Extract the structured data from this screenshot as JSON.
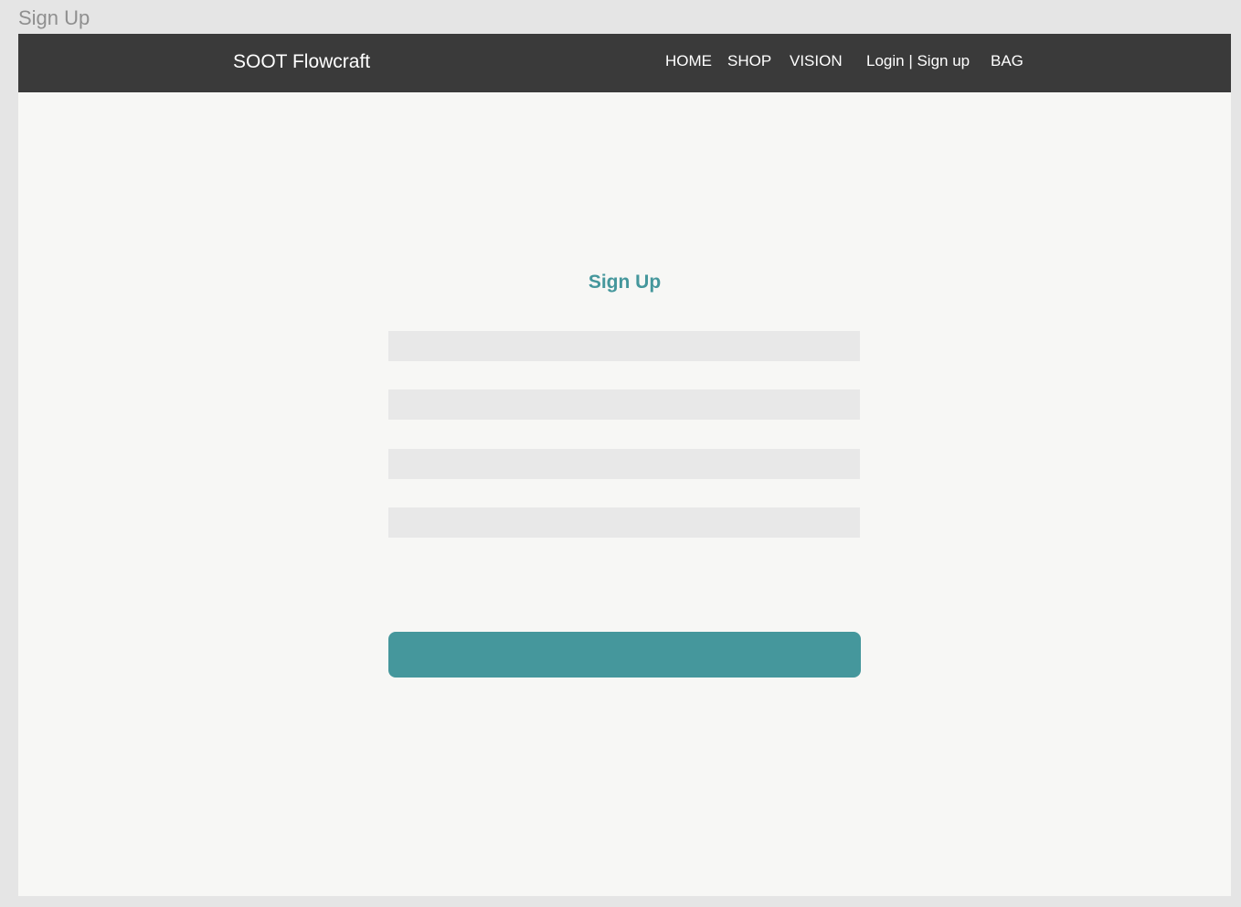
{
  "frame_label": "Sign Up",
  "navbar": {
    "brand": "SOOT Flowcraft",
    "links": {
      "home": "HOME",
      "shop": "SHOP",
      "vision": "VISION",
      "login_signup": "Login | Sign up",
      "bag": "BAG"
    }
  },
  "form": {
    "title": "Sign Up",
    "fields": [
      {
        "value": "",
        "placeholder": ""
      },
      {
        "value": "",
        "placeholder": ""
      },
      {
        "value": "",
        "placeholder": ""
      },
      {
        "value": "",
        "placeholder": ""
      }
    ],
    "submit_label": ""
  },
  "colors": {
    "accent": "#45979c",
    "navbar_bg": "#3a3a3a",
    "page_bg": "#f7f7f5",
    "field_bg": "#e8e8e8"
  }
}
